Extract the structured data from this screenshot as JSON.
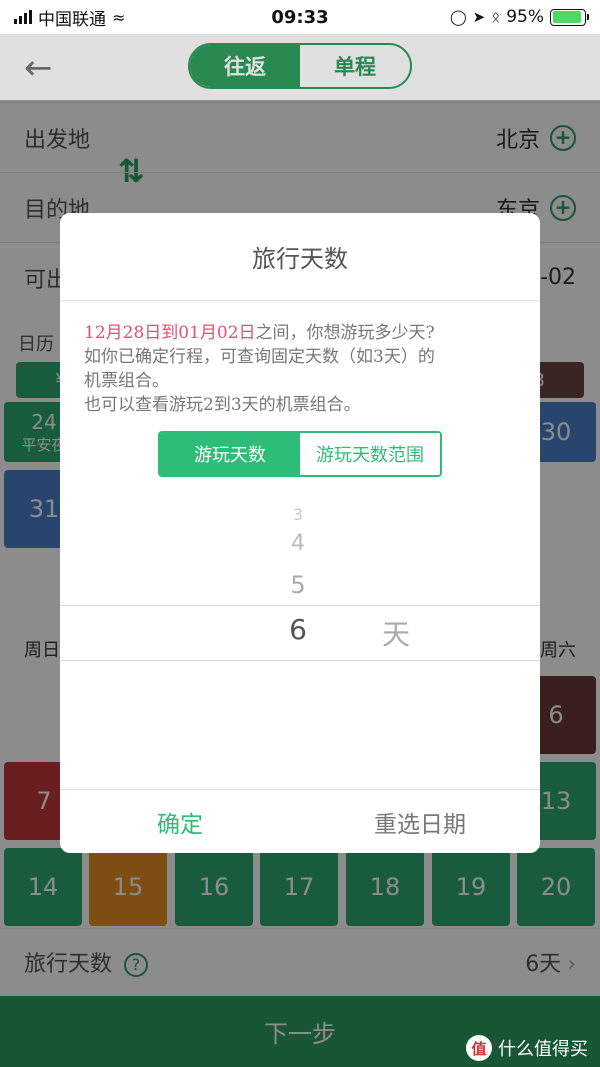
{
  "status": {
    "carrier": "中国联通",
    "time": "09:33",
    "battery": "95%"
  },
  "header": {
    "tabs": [
      {
        "label": "往返",
        "active": true
      },
      {
        "label": "单程",
        "active": false
      }
    ]
  },
  "route": {
    "origin_label": "出发地",
    "origin_value": "北京",
    "dest_label": "目的地",
    "dest_value": "东京",
    "avail_label": "可出",
    "avail_value": "-02"
  },
  "calendar": {
    "label": "日历",
    "partial_tiles": [
      {
        "text": "¥",
        "color": "#2ea870"
      },
      {
        "text": "8",
        "color": "#6b4444"
      },
      {
        "text": "24",
        "sub": "平安夜",
        "color": "#2ea870"
      },
      {
        "text": "30",
        "color": "#4a7fc8"
      },
      {
        "text": "31",
        "color": "#4a7fc8"
      }
    ],
    "weekday_first": "周日",
    "weekday_last": "周六",
    "row1_last": {
      "text": "6",
      "color": "#6b3a3a"
    },
    "row2": [
      {
        "text": "7",
        "color": "#c0383a"
      },
      {
        "text": "13",
        "color": "#2ea870"
      }
    ],
    "row3": [
      {
        "text": "14",
        "color": "#2ea870"
      },
      {
        "text": "15",
        "color": "#e28e20"
      },
      {
        "text": "16",
        "color": "#2ea870"
      },
      {
        "text": "17",
        "color": "#2ea870"
      },
      {
        "text": "18",
        "color": "#2ea870"
      },
      {
        "text": "19",
        "color": "#2ea870"
      },
      {
        "text": "20",
        "color": "#2ea870"
      }
    ]
  },
  "trip_days": {
    "label": "旅行天数",
    "help": "?",
    "value": "6天"
  },
  "next_button": "下一步",
  "watermark": {
    "icon": "值",
    "text": "什么值得买"
  },
  "modal": {
    "title": "旅行天数",
    "msg_date_range": "12月28日到01月02日",
    "msg_line1_rest": "之间，你想游玩多少天?",
    "msg_line2": "如你已确定行程，可查询固定天数（如3天）的",
    "msg_line3": "机票组合。",
    "msg_line4": "也可以查看游玩2到3天的机票组合。",
    "mode_tabs": [
      {
        "label": "游玩天数",
        "active": true
      },
      {
        "label": "游玩天数范围",
        "active": false
      }
    ],
    "picker": {
      "faded": [
        "3",
        "4",
        "5"
      ],
      "selected": "6",
      "unit": "天"
    },
    "confirm": "确定",
    "reselect": "重选日期"
  },
  "colors": {
    "brand_green": "#2e9d5d",
    "accent_green": "#2ebd76",
    "highlight_red": "#e8506a"
  }
}
